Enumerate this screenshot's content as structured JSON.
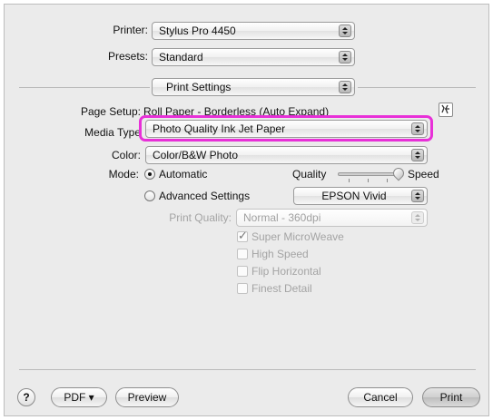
{
  "printer": {
    "label": "Printer:",
    "value": "Stylus Pro 4450"
  },
  "presets": {
    "label": "Presets:",
    "value": "Standard"
  },
  "panel": {
    "value": "Print Settings"
  },
  "page_setup": {
    "label": "Page Setup:",
    "value": "Roll Paper - Borderless (Auto Expand)",
    "icon": "utility-icon"
  },
  "media_type": {
    "label": "Media Type",
    "value": "Photo Quality Ink Jet Paper",
    "highlight_color": "#e830d8"
  },
  "color": {
    "label": "Color:",
    "value": "Color/B&W Photo"
  },
  "mode": {
    "label": "Mode:",
    "automatic": "Automatic",
    "advanced": "Advanced Settings",
    "quality_label": "Quality",
    "speed_label": "Speed",
    "slider_value": 1.0,
    "advanced_profile": "EPSON Vivid",
    "selected": "Automatic"
  },
  "print_quality": {
    "label": "Print Quality:",
    "value": "Normal - 360dpi"
  },
  "options": [
    {
      "label": "Super MicroWeave",
      "checked": true
    },
    {
      "label": "High Speed",
      "checked": false
    },
    {
      "label": "Flip Horizontal",
      "checked": false
    },
    {
      "label": "Finest Detail",
      "checked": false
    }
  ],
  "footer": {
    "help": "?",
    "pdf": "PDF ▾",
    "preview": "Preview",
    "cancel": "Cancel",
    "print": "Print"
  }
}
